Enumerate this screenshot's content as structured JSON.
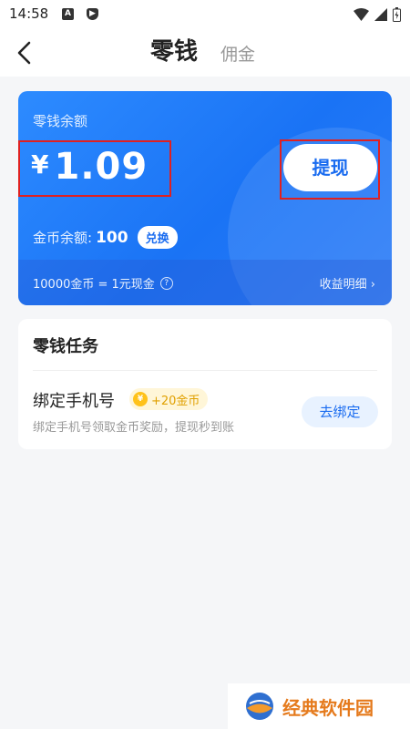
{
  "status_bar": {
    "time": "14:58"
  },
  "nav": {
    "title": "零钱",
    "secondary_tab": "佣金"
  },
  "balance": {
    "label": "零钱余额",
    "currency_symbol": "¥",
    "amount": "1.09",
    "withdraw_label": "提现",
    "coin_label": "金币余额:",
    "coin_value": "100",
    "exchange_label": "兑换",
    "rate_text": "10000金币 = 1元现金",
    "detail_link": "收益明细",
    "colors": {
      "card_start": "#2d8bff",
      "card_end": "#1a73f5",
      "highlight_box": "#e02020"
    }
  },
  "tasks": {
    "title": "零钱任务",
    "items": [
      {
        "name": "绑定手机号",
        "reward": "+20金币",
        "description": "绑定手机号领取金币奖励，提现秒到账",
        "action": "去绑定"
      }
    ]
  },
  "watermark": {
    "text": "经典软件园"
  }
}
